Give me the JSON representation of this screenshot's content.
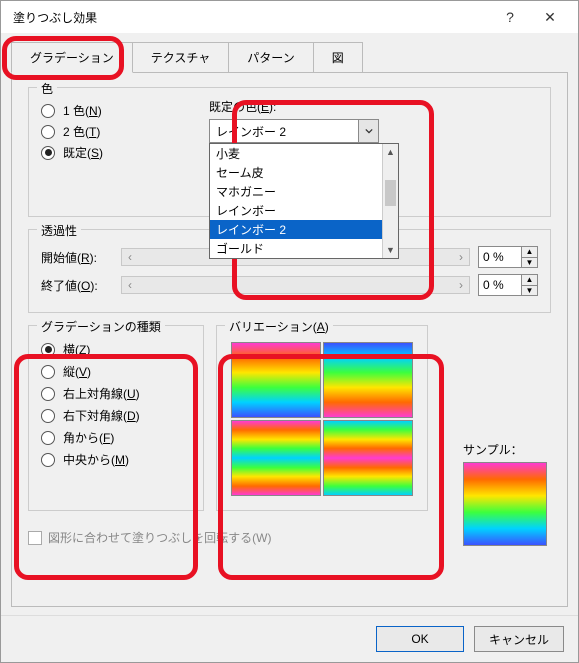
{
  "title": "塗りつぶし効果",
  "tabs": {
    "gradient": "グラデーション",
    "texture": "テクスチャ",
    "pattern": "パターン",
    "picture": "図"
  },
  "colors": {
    "legend": "色",
    "one": "1 色(",
    "one_k": "N",
    "two": "2 色(",
    "two_k": "T",
    "preset": "既定(",
    "preset_k": "S",
    "close": ")"
  },
  "preset": {
    "label_pre": "既定の色(",
    "label_k": "E",
    "label_post": "):",
    "selected": "レインボー 2",
    "options": [
      "小麦",
      "セーム皮",
      "マホガニー",
      "レインボー",
      "レインボー 2",
      "ゴールド"
    ]
  },
  "transparency": {
    "legend": "透過性",
    "from_pre": "開始値(",
    "from_k": "R",
    "from_post": "):",
    "to_pre": "終了値(",
    "to_k": "O",
    "to_post": "):",
    "from_val": "0 %",
    "to_val": "0 %"
  },
  "style": {
    "legend": "グラデーションの種類",
    "items": [
      {
        "label": "横(",
        "k": "Z",
        "checked": true
      },
      {
        "label": "縦(",
        "k": "V",
        "checked": false
      },
      {
        "label": "右上対角線(",
        "k": "U",
        "checked": false
      },
      {
        "label": "右下対角線(",
        "k": "D",
        "checked": false
      },
      {
        "label": "角から(",
        "k": "F",
        "checked": false
      },
      {
        "label": "中央から(",
        "k": "M",
        "checked": false
      }
    ]
  },
  "variants": {
    "legend_pre": "バリエーション(",
    "legend_k": "A",
    "legend_post": ")"
  },
  "sample": {
    "label": "サンプル："
  },
  "rotate": {
    "label": "図形に合わせて塗りつぶしを回転する(W)"
  },
  "buttons": {
    "ok": "OK",
    "cancel": "キャンセル"
  }
}
